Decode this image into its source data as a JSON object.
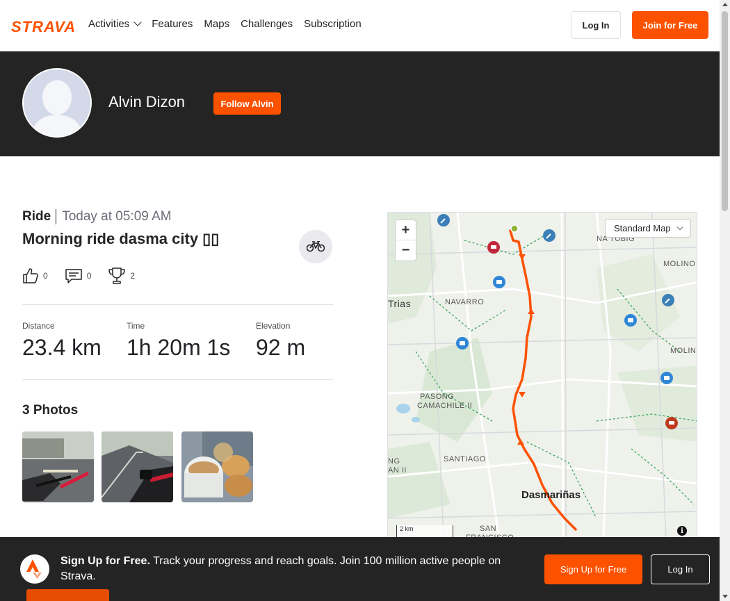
{
  "nav": {
    "logo": "STRAVA",
    "links": [
      "Activities",
      "Features",
      "Maps",
      "Challenges",
      "Subscription"
    ],
    "login_label": "Log In",
    "join_label": "Join for Free"
  },
  "athlete": {
    "name": "Alvin Dizon",
    "follow_label": "Follow Alvin"
  },
  "activity": {
    "type": "Ride",
    "time": "Today at 05:09 AM",
    "title": "Morning ride dasma city ▯▯",
    "sport_icon": "bike-icon",
    "kudos": "0",
    "comments": "0",
    "achievements": "2",
    "stats": [
      {
        "label": "Distance",
        "value": "23.4 km"
      },
      {
        "label": "Time",
        "value": "1h 20m 1s"
      },
      {
        "label": "Elevation",
        "value": "92 m"
      }
    ],
    "photos_title": "3 Photos"
  },
  "map": {
    "zoom_in": "+",
    "zoom_out": "−",
    "map_type": "Standard Map",
    "scale": "2 km",
    "info": "i",
    "labels": {
      "na_tubig": "NA TUBIG",
      "molino": "MOLINO",
      "molino2": "MOLIN",
      "trias": "Trias",
      "navarro": "NAVARRO",
      "pasong": "PASONG",
      "camachile": "CAMACHILE II",
      "santiago": "SANTIAGO",
      "ng": "NG",
      "an_ii": "AN II",
      "dasmarinas": "Dasmariñas",
      "san": "SAN",
      "francisco": "FRANCISCO"
    },
    "accent_color": "#fc5200"
  },
  "footer": {
    "lead": "Sign Up for Free.",
    "text": " Track your progress and reach goals. Join 100 million active people on Strava.",
    "signup_label": "Sign Up for Free",
    "login_label": "Log In"
  }
}
